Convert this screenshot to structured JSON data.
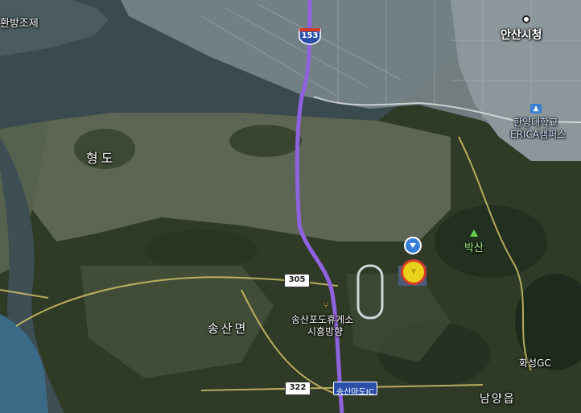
{
  "colors": {
    "water": "#3a4a4e",
    "tidal_flat": "#5d6654",
    "land": "#2f3a27",
    "urban": "#7d8a8f",
    "expressway": "#8f62e0",
    "highway_shield": "#2a4fa8",
    "national_road_shield": "#ffffff",
    "marker_blue": "#3a7fd5",
    "marker_yellow": "#e9d21a",
    "marker_red": "#d43a2a",
    "peak_icon": "#62d04a"
  },
  "labels": {
    "hwajo": "환방조제",
    "ansan_city_hall": "안산시청",
    "hanyang_univ_line1": "한양대학교",
    "hanyang_univ_line2": "ERICA캠퍼스",
    "hyeongdo": "형도",
    "baksan": "박산",
    "songsan_myeon": "송산면",
    "rest_area_line1": "송산포도휴게소",
    "rest_area_line2": "시흥방향",
    "hwaseong_gc": "화성GC",
    "namyang_eup": "남양읍",
    "songsan_ic": "송산마도IC"
  },
  "shields": {
    "expressway_153": "153",
    "route_305": "305",
    "route_322": "322"
  },
  "icons": {
    "city_hall": "city-hall-dot-icon",
    "university": "university-icon",
    "mountain": "mountain-peak-icon",
    "rest_area": "rest-area-icon",
    "location_marker": "location-marker-icon",
    "selected_marker": "selected-marker-icon"
  }
}
